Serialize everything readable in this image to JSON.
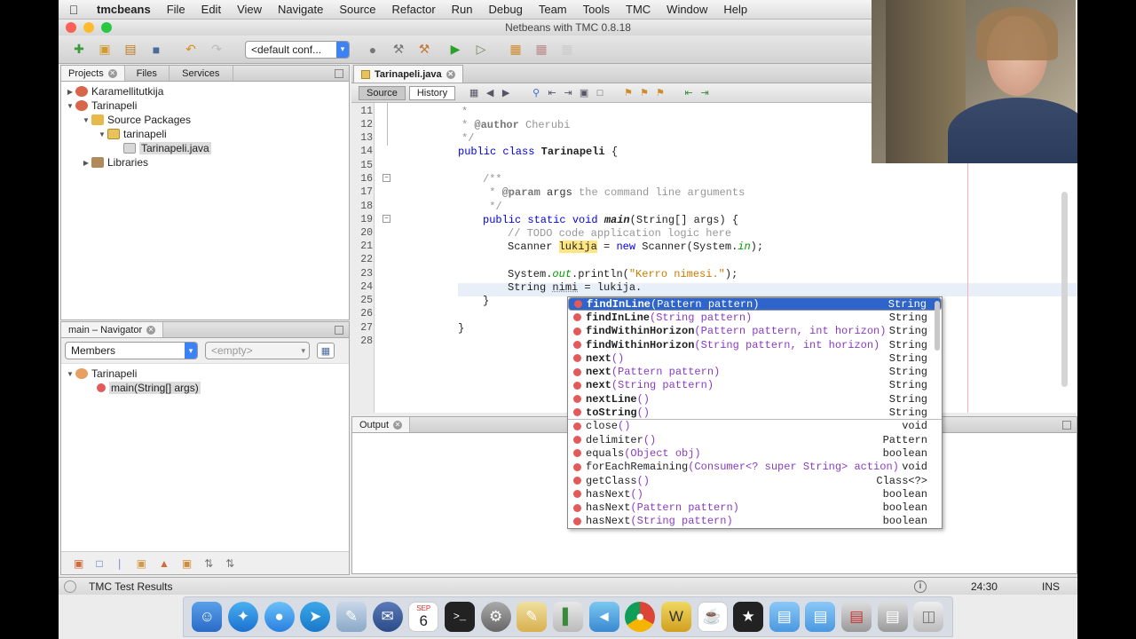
{
  "menubar": {
    "app_name": "tmcbeans",
    "items": [
      "File",
      "Edit",
      "View",
      "Navigate",
      "Source",
      "Refactor",
      "Run",
      "Debug",
      "Team",
      "Tools",
      "TMC",
      "Window",
      "Help"
    ]
  },
  "window": {
    "title": "Netbeans with TMC 0.8.18"
  },
  "toolbar": {
    "config_select": "<default conf..."
  },
  "projects_panel": {
    "tabs": [
      "Projects",
      "Files",
      "Services"
    ],
    "tree": [
      {
        "label": "Karamellitutkija",
        "level": 0,
        "toggle": "▶"
      },
      {
        "label": "Tarinapeli",
        "level": 0,
        "toggle": "▼"
      },
      {
        "label": "Source Packages",
        "level": 1,
        "toggle": "▼"
      },
      {
        "label": "tarinapeli",
        "level": 2,
        "toggle": "▼"
      },
      {
        "label": "Tarinapeli.java",
        "level": 3,
        "toggle": ""
      },
      {
        "label": "Libraries",
        "level": 1,
        "toggle": "▶"
      }
    ]
  },
  "navigator_panel": {
    "title": "main – Navigator",
    "members_select": "Members",
    "filter_select": "<empty>",
    "tree": [
      {
        "label": "Tarinapeli"
      },
      {
        "label": "main(String[] args)"
      }
    ]
  },
  "editor": {
    "tab": "Tarinapeli.java",
    "source_label": "Source",
    "history_label": "History",
    "line_numbers": [
      "11",
      "12",
      "13",
      "14",
      "15",
      "16",
      "17",
      "18",
      "19",
      "20",
      "21",
      "22",
      "23",
      "24",
      "25",
      "26",
      "27",
      "28"
    ]
  },
  "completion": {
    "items": [
      {
        "name": "findInLine",
        "params": "(Pattern pattern)",
        "ret": "String"
      },
      {
        "name": "findInLine",
        "params": "(String pattern)",
        "ret": "String"
      },
      {
        "name": "findWithinHorizon",
        "params": "(Pattern pattern, int horizon)",
        "ret": "String"
      },
      {
        "name": "findWithinHorizon",
        "params": "(String pattern, int horizon)",
        "ret": "String"
      },
      {
        "name": "next",
        "params": "()",
        "ret": "String"
      },
      {
        "name": "next",
        "params": "(Pattern pattern)",
        "ret": "String"
      },
      {
        "name": "next",
        "params": "(String pattern)",
        "ret": "String"
      },
      {
        "name": "nextLine",
        "params": "()",
        "ret": "String"
      },
      {
        "name": "toString",
        "params": "()",
        "ret": "String"
      },
      {
        "name": "close",
        "params": "()",
        "ret": "void"
      },
      {
        "name": "delimiter",
        "params": "()",
        "ret": "Pattern"
      },
      {
        "name": "equals",
        "params": "(Object obj)",
        "ret": "boolean"
      },
      {
        "name": "forEachRemaining",
        "params": "(Consumer<? super String> action)",
        "ret": "void"
      },
      {
        "name": "getClass",
        "params": "()",
        "ret": "Class<?>"
      },
      {
        "name": "hasNext",
        "params": "()",
        "ret": "boolean"
      },
      {
        "name": "hasNext",
        "params": "(Pattern pattern)",
        "ret": "boolean"
      },
      {
        "name": "hasNext",
        "params": "(String pattern)",
        "ret": "boolean"
      }
    ]
  },
  "output": {
    "tab": "Output"
  },
  "statusbar": {
    "tmc_results": "TMC Test Results",
    "position": "24:30",
    "mode": "INS"
  },
  "dock": {
    "calendar_month": "SEP",
    "calendar_day": "6"
  }
}
